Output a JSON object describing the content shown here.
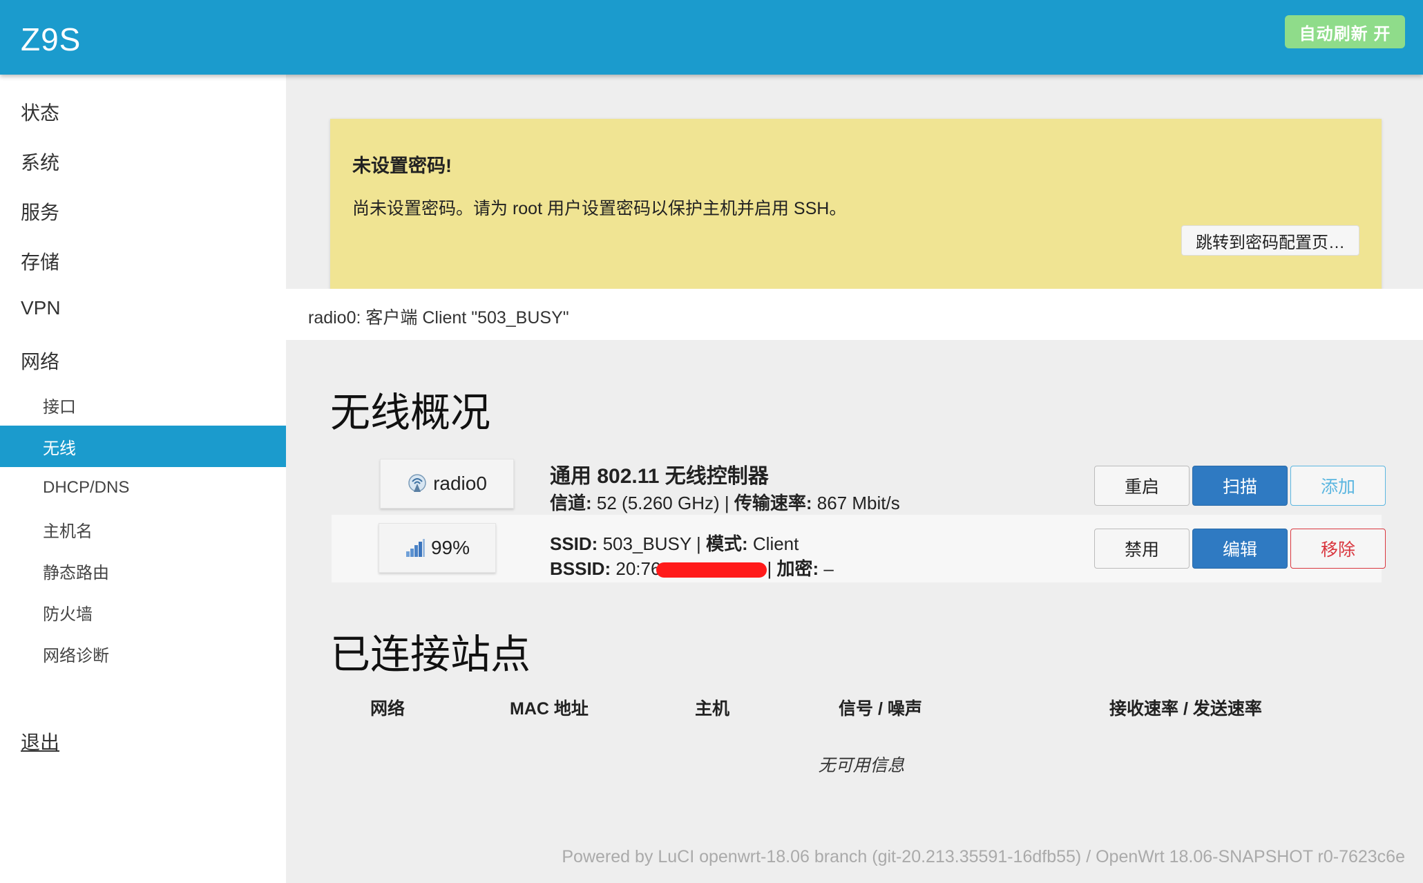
{
  "header": {
    "brand": "Z9S",
    "refresh_label": "自动刷新 开"
  },
  "sidebar": {
    "items": [
      {
        "label": "状态"
      },
      {
        "label": "系统"
      },
      {
        "label": "服务"
      },
      {
        "label": "存储"
      },
      {
        "label": "VPN"
      },
      {
        "label": "网络"
      }
    ],
    "subitems": [
      {
        "label": "接口"
      },
      {
        "label": "无线"
      },
      {
        "label": "DHCP/DNS"
      },
      {
        "label": "主机名"
      },
      {
        "label": "静态路由"
      },
      {
        "label": "防火墙"
      },
      {
        "label": "网络诊断"
      }
    ],
    "active_subitem": "无线",
    "logout_label": "退出"
  },
  "alert": {
    "title": "未设置密码!",
    "text": "尚未设置密码。请为 root 用户设置密码以保护主机并启用 SSH。",
    "button_label": "跳转到密码配置页…",
    "background_color": "#f0e493"
  },
  "notice": {
    "text": "radio0: 客户端 Client \"503_BUSY\""
  },
  "wireless": {
    "title": "无线概况",
    "radio": {
      "badge_label": "radio0",
      "icon": "wifi-radio-icon",
      "controller_title": "通用 802.11 无线控制器",
      "channel_label": "信道:",
      "channel_value": "52 (5.260 GHz)",
      "separator": "|",
      "rate_label": "传输速率:",
      "rate_value": "867 Mbit/s",
      "buttons": {
        "restart": "重启",
        "scan": "扫描",
        "add": "添加"
      }
    },
    "network": {
      "signal_label": "99%",
      "signal_percent": 99,
      "icon": "signal-bars-icon",
      "ssid_label": "SSID:",
      "ssid_value": "503_BUSY",
      "mode_label": "模式:",
      "mode_value": "Client",
      "bssid_label": "BSSID:",
      "bssid_value": "20:76",
      "encryption_label": "加密:",
      "encryption_value": "–",
      "buttons": {
        "disable": "禁用",
        "edit": "编辑",
        "remove": "移除"
      }
    }
  },
  "stations": {
    "title": "已连接站点",
    "columns": [
      "网络",
      "MAC 地址",
      "主机",
      "信号 / 噪声",
      "接收速率 / 发送速率"
    ],
    "empty_text": "无可用信息"
  },
  "footer": {
    "text": "Powered by LuCI openwrt-18.06 branch (git-20.213.35591-16dfb55) / OpenWrt 18.06-SNAPSHOT r0-7623c6e"
  },
  "colors": {
    "header": "#1b9bcd",
    "refresh": "#8fdc8a",
    "primary": "#2f7ac2",
    "danger": "#d9363e",
    "info": "#5bb6e0"
  }
}
